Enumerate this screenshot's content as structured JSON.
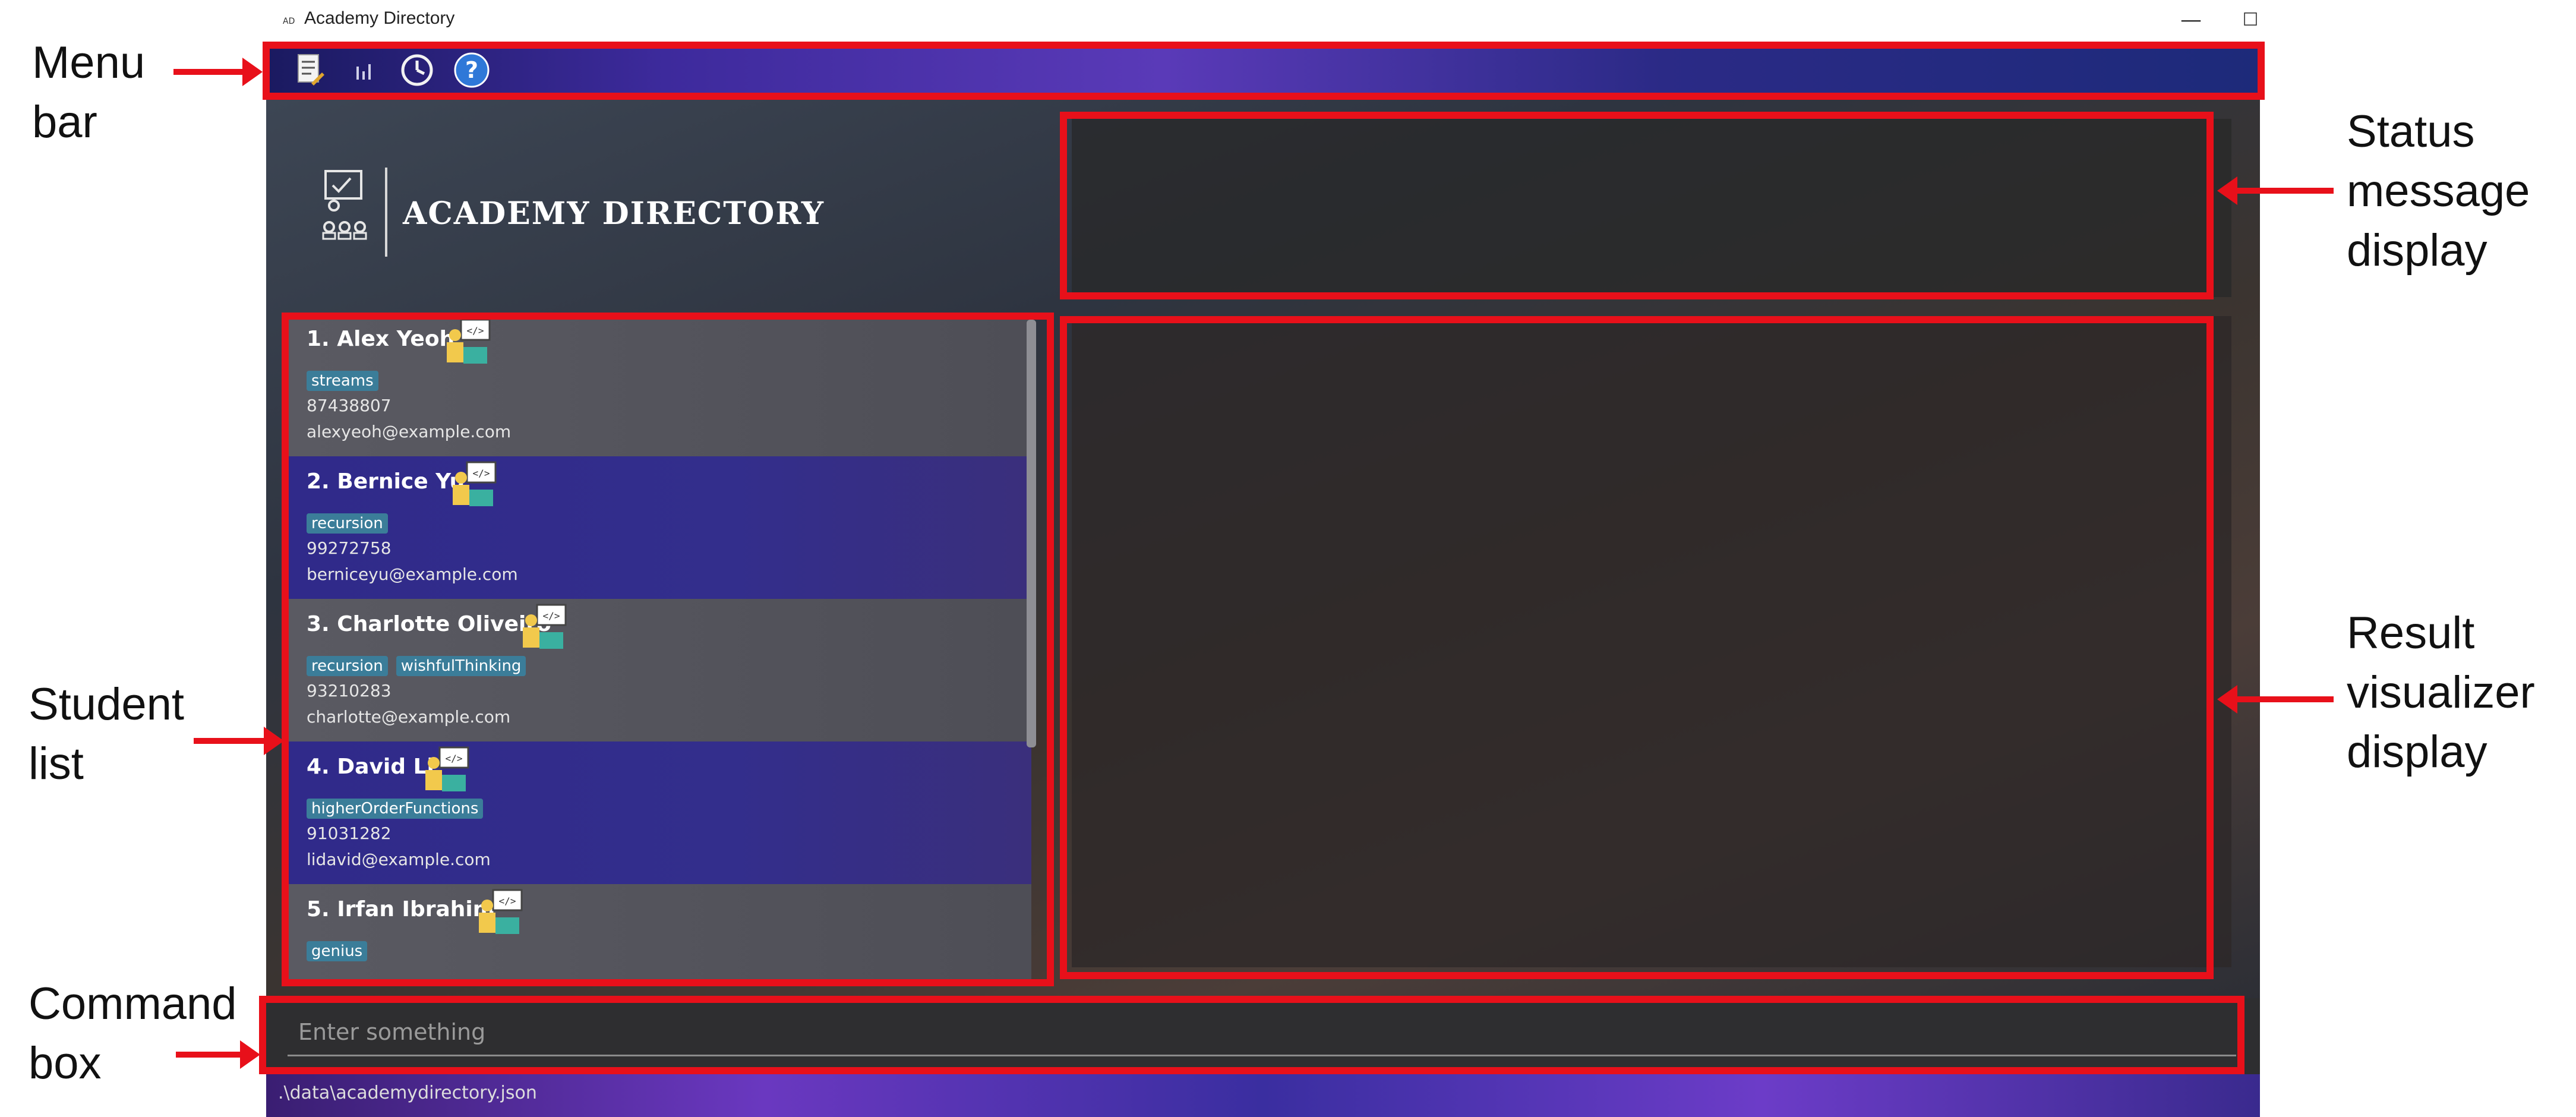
{
  "annotations": {
    "menu_bar": [
      "Menu",
      "bar"
    ],
    "student_list": [
      "Student",
      "list"
    ],
    "command_box": [
      "Command",
      "box"
    ],
    "status_message": [
      "Status",
      "message",
      "display"
    ],
    "result_visualizer": [
      "Result",
      "visualizer",
      "display"
    ]
  },
  "window": {
    "icon_text": "AD",
    "title": "Academy Directory",
    "minimize": "—",
    "maximize": "☐",
    "close": "✕"
  },
  "menu": {
    "icons": [
      "edit-document-icon",
      "bar-chart-icon",
      "history-clock-icon",
      "help-icon"
    ]
  },
  "logo": {
    "text": "ACADEMY DIRECTORY"
  },
  "students": [
    {
      "index": "1.",
      "name": "Alex Yeoh",
      "tags": [
        "streams"
      ],
      "phone": "87438807",
      "email": "alexyeoh@example.com"
    },
    {
      "index": "2.",
      "name": "Bernice Yu",
      "tags": [
        "recursion"
      ],
      "phone": "99272758",
      "email": "berniceyu@example.com"
    },
    {
      "index": "3.",
      "name": "Charlotte Oliveiro",
      "tags": [
        "recursion",
        "wishfulThinking"
      ],
      "phone": "93210283",
      "email": "charlotte@example.com"
    },
    {
      "index": "4.",
      "name": "David Li",
      "tags": [
        "higherOrderFunctions"
      ],
      "phone": "91031282",
      "email": "lidavid@example.com"
    },
    {
      "index": "5.",
      "name": "Irfan Ibrahim",
      "tags": [
        "genius"
      ],
      "phone": "",
      "email": ""
    }
  ],
  "command": {
    "placeholder": "Enter something"
  },
  "statusbar": {
    "path": ".\\data\\academydirectory.json"
  },
  "colors": {
    "annotation": "#e8101a",
    "tag": "#3b7d99"
  }
}
